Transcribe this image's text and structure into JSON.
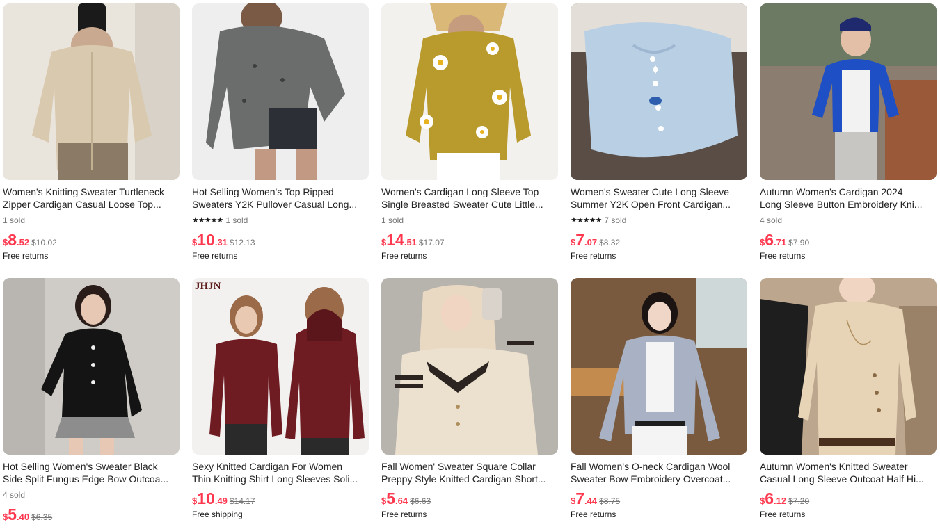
{
  "products": [
    {
      "title_line1": "Women's Knitting Sweater Turtleneck",
      "title_line2": "Zipper Cardigan Casual Loose Top...",
      "stars": "",
      "sold": "1 sold",
      "currency": "$",
      "price_int": "8",
      "price_dec": ".52",
      "old_price": "$10.02",
      "shipping": "Free returns",
      "colors": {
        "bg": "#e9e4dc",
        "garment": "#d9c9ae",
        "accent": "#8a7a66"
      }
    },
    {
      "title_line1": "Hot Selling Women's Top Ripped",
      "title_line2": "Sweaters Y2K Pullover Casual Long...",
      "stars": "★★★★★",
      "sold": "1 sold",
      "currency": "$",
      "price_int": "10",
      "price_dec": ".31",
      "old_price": "$12.13",
      "shipping": "Free returns",
      "colors": {
        "bg": "#eeeeee",
        "garment": "#6b6d6c",
        "accent": "#3b3d3e"
      }
    },
    {
      "title_line1": "Women's Cardigan Long Sleeve Top",
      "title_line2": "Single Breasted Sweater Cute Little...",
      "stars": "",
      "sold": "1 sold",
      "currency": "$",
      "price_int": "14",
      "price_dec": ".51",
      "old_price": "$17.07",
      "shipping": "Free returns",
      "colors": {
        "bg": "#f3f1ee",
        "garment": "#b99a2c",
        "accent": "#ffffff"
      }
    },
    {
      "title_line1": "Women's Sweater Cute Long Sleeve",
      "title_line2": "Summer Y2K Open Front Cardigan...",
      "stars": "★★★★★",
      "sold": "7 sold",
      "currency": "$",
      "price_int": "7",
      "price_dec": ".07",
      "old_price": "$8.32",
      "shipping": "Free returns",
      "colors": {
        "bg": "#5a4d45",
        "garment": "#b9cfe4",
        "accent": "#2d5fae"
      }
    },
    {
      "title_line1": "Autumn Women's Cardigan 2024",
      "title_line2": "Long Sleeve Button Embroidery Kni...",
      "stars": "",
      "sold": "4 sold",
      "currency": "$",
      "price_int": "6",
      "price_dec": ".71",
      "old_price": "$7.90",
      "shipping": "Free returns",
      "colors": {
        "bg": "#8b7d6f",
        "garment": "#1f4fc4",
        "accent": "#c8c6c2"
      }
    },
    {
      "title_line1": "Hot Selling Women's Sweater Black",
      "title_line2": "Side Split Fungus Edge Bow Outcoa...",
      "stars": "",
      "sold": "4 sold",
      "currency": "$",
      "price_int": "5",
      "price_dec": ".40",
      "old_price": "$6.35",
      "shipping": "",
      "colors": {
        "bg": "#cfcbc6",
        "garment": "#141414",
        "accent": "#8d8d8d"
      }
    },
    {
      "title_line1": "Sexy Knitted Cardigan For Women",
      "title_line2": "Thin Knitting Shirt Long Sleeves Soli...",
      "stars": "",
      "sold": "",
      "currency": "$",
      "price_int": "10",
      "price_dec": ".49",
      "old_price": "$14.17",
      "shipping": "Free shipping",
      "logo": "JHJN",
      "colors": {
        "bg": "#f2f1f0",
        "garment": "#6e1c22",
        "accent": "#2a2a2a"
      }
    },
    {
      "title_line1": "Fall Women' Sweater Square Collar",
      "title_line2": "Preppy Style Knitted Cardigan Short...",
      "stars": "",
      "sold": "",
      "currency": "$",
      "price_int": "5",
      "price_dec": ".64",
      "old_price": "$6.63",
      "shipping": "Free returns",
      "colors": {
        "bg": "#b7b3ad",
        "garment": "#ece1cf",
        "accent": "#2b2421"
      }
    },
    {
      "title_line1": "Fall Women's O-neck Cardigan Wool",
      "title_line2": "Sweater Bow Embroidery Overcoat...",
      "stars": "",
      "sold": "",
      "currency": "$",
      "price_int": "7",
      "price_dec": ".44",
      "old_price": "$8.75",
      "shipping": "Free returns",
      "colors": {
        "bg": "#7a5a3e",
        "garment": "#a9b2c4",
        "accent": "#f4f4f4"
      }
    },
    {
      "title_line1": "Autumn Women's Knitted Sweater",
      "title_line2": "Casual Long Sleeve Outcoat Half Hi...",
      "stars": "",
      "sold": "",
      "currency": "$",
      "price_int": "6",
      "price_dec": ".12",
      "old_price": "$7.20",
      "shipping": "Free returns",
      "colors": {
        "bg": "#bca78e",
        "garment": "#e7d3b6",
        "accent": "#1e1e1e"
      }
    }
  ]
}
